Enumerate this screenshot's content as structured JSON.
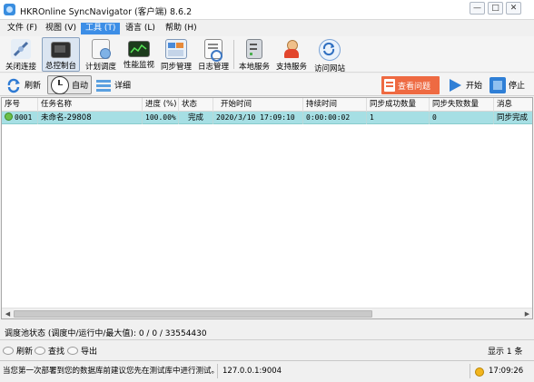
{
  "window": {
    "title": "HKROnline SyncNavigator (客户端) 8.6.2",
    "minimize": "—",
    "restore": "□",
    "close": "✕"
  },
  "menu": [
    "文件 (F)",
    "视图 (V)",
    "工具 (T)",
    "语言 (L)",
    "帮助 (H)"
  ],
  "toolbar1": [
    "关闭连接",
    "总控制台",
    "计划调度",
    "性能监视",
    "同步管理",
    "日志管理",
    "本地服务",
    "支持服务",
    "访问网站"
  ],
  "toolbar2": {
    "refresh": "刷新",
    "auto": "自动",
    "details": "详细",
    "view_issues": "查看问题",
    "start": "开始",
    "stop": "停止"
  },
  "grid": {
    "columns": [
      "序号",
      "任务名称",
      "进度 (%)",
      "状态",
      "开始时间",
      "持续时间",
      "同步成功数量",
      "同步失败数量",
      "消息"
    ],
    "rows": [
      [
        "0001",
        "未命名-29808",
        "100.00%",
        "完成",
        "2020/3/10  17:09:10",
        "0:00:00:02",
        "1",
        "0",
        "同步完成"
      ]
    ]
  },
  "pool_status": "调度池状态 (调度中/运行中/最大值): 0 / 0 / 33554430",
  "footer_buttons": [
    "刷新",
    "查找",
    "导出"
  ],
  "count_label": "显示 1 条",
  "statusbar": {
    "message": "当您第一次部署到您的数据库前建议您先在测试库中进行测试。",
    "address": "127.0.0.1:9004",
    "time": "17:09:26"
  },
  "colors": {
    "accent": "#3d8ee6",
    "selected_row": "#a6dfe4",
    "issues_button": "#ee6a42"
  }
}
